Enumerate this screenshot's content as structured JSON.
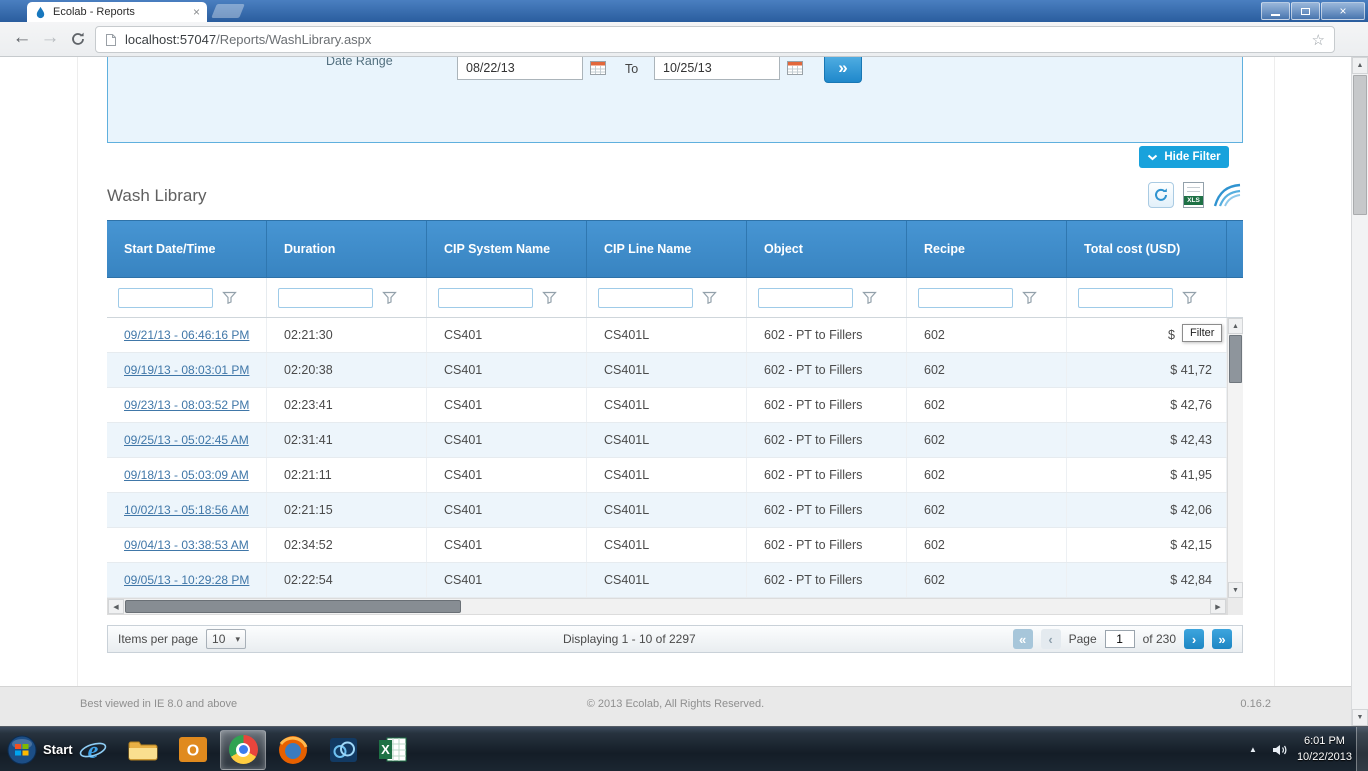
{
  "browser": {
    "tab_title": "Ecolab - Reports",
    "url_host": "localhost:57047",
    "url_path": "/Reports/WashLibrary.aspx"
  },
  "filter_panel": {
    "date_range_label": "Date Range",
    "from_value": "08/22/13",
    "to_label": "To",
    "to_value": "10/25/13",
    "hide_filter_label": "Hide Filter"
  },
  "report": {
    "title": "Wash Library"
  },
  "table": {
    "columns": [
      "Start Date/Time",
      "Duration",
      "CIP System Name",
      "CIP Line Name",
      "Object",
      "Recipe",
      "Total cost (USD)"
    ],
    "rows": [
      [
        "09/21/13 - 06:46:16 PM",
        "02:21:30",
        "CS401",
        "CS401L",
        "602 - PT to Fillers",
        "602",
        "$"
      ],
      [
        "09/19/13 - 08:03:01 PM",
        "02:20:38",
        "CS401",
        "CS401L",
        "602 - PT to Fillers",
        "602",
        "$ 41,72"
      ],
      [
        "09/23/13 - 08:03:52 PM",
        "02:23:41",
        "CS401",
        "CS401L",
        "602 - PT to Fillers",
        "602",
        "$ 42,76"
      ],
      [
        "09/25/13 - 05:02:45 AM",
        "02:31:41",
        "CS401",
        "CS401L",
        "602 - PT to Fillers",
        "602",
        "$ 42,43"
      ],
      [
        "09/18/13 - 05:03:09 AM",
        "02:21:11",
        "CS401",
        "CS401L",
        "602 - PT to Fillers",
        "602",
        "$ 41,95"
      ],
      [
        "10/02/13 - 05:18:56 AM",
        "02:21:15",
        "CS401",
        "CS401L",
        "602 - PT to Fillers",
        "602",
        "$ 42,06"
      ],
      [
        "09/04/13 - 03:38:53 AM",
        "02:34:52",
        "CS401",
        "CS401L",
        "602 - PT to Fillers",
        "602",
        "$ 42,15"
      ],
      [
        "09/05/13 - 10:29:28 PM",
        "02:22:54",
        "CS401",
        "CS401L",
        "602 - PT to Fillers",
        "602",
        "$ 42,84"
      ]
    ],
    "tooltip": "Filter"
  },
  "pagination": {
    "items_per_page_label": "Items per page",
    "items_per_page_value": "10",
    "displaying_text": "Displaying 1 - 10 of 2297",
    "page_label": "Page",
    "page_value": "1",
    "total_pages_label": "of 230"
  },
  "footer": {
    "left_text": "Best viewed in IE 8.0 and above",
    "center_text": "© 2013 Ecolab, All Rights Reserved.",
    "right_text": "0.16.2"
  },
  "taskbar": {
    "start_label": "Start",
    "tray_time": "6:01 PM",
    "tray_date": "10/22/2013"
  },
  "colors": {
    "header_blue": "#3e8cca",
    "accent_blue": "#18a2dc",
    "link_blue": "#4077a8",
    "row_alt": "#edf5fb"
  },
  "glyphs": {
    "back": "←",
    "forward": "→",
    "star": "☆",
    "apply": "»",
    "first": "«",
    "prev": "‹",
    "next": "›",
    "last": "»",
    "dropdown": "▾",
    "up": "▲",
    "down": "▼",
    "left": "◀",
    "right": "▶",
    "tray_expand": "▲",
    "close": "×"
  }
}
